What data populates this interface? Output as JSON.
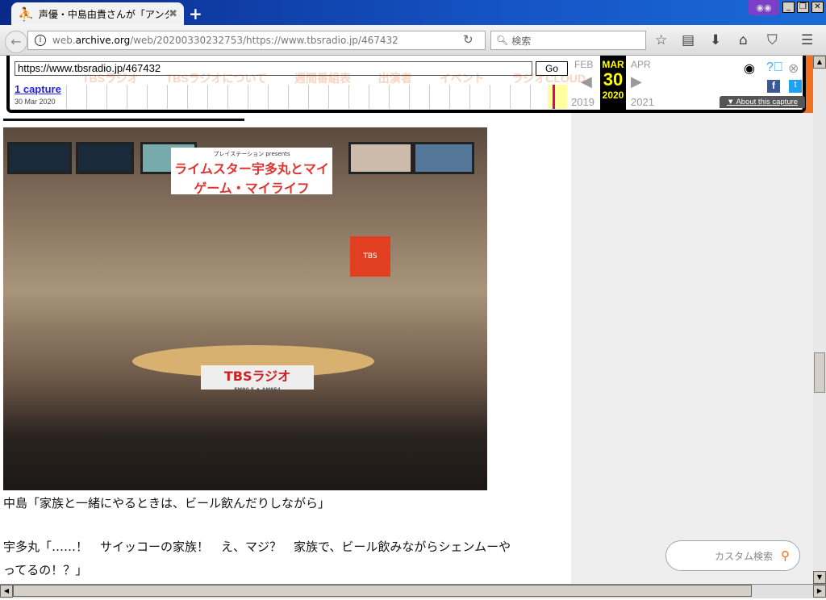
{
  "browser": {
    "tab_title": "声優・中島由貴さんが「アンダ…",
    "url_host_prefix": "web.",
    "url_host": "archive.org",
    "url_path": "/web/20200330232753/https://www.tbsradio.jp/467432",
    "search_placeholder": "検索"
  },
  "wayback": {
    "url": "https://www.tbsradio.jp/467432",
    "go": "Go",
    "captures": "1 capture",
    "capture_date": "30 Mar 2020",
    "prev_month": "FEB",
    "month": "MAR",
    "next_month": "APR",
    "day": "30",
    "prev_year": "2019",
    "year": "2020",
    "next_year": "2021",
    "about": "About this capture"
  },
  "site_nav": [
    "TBSラジオ",
    "TBSラジオについて",
    "週間番組表",
    "出演者",
    "イベント",
    "ラジオCLOUD"
  ],
  "photo": {
    "sign_small": "プレイステーション presents",
    "sign_title": "ライムスター宇多丸とマイゲーム・マイライフ",
    "desk_sign": "TBSラジオ",
    "desk_sub": "FM90.5 ♦ AM954"
  },
  "article": {
    "line1": "中島「家族と一緒にやるときは、ビール飲んだりしながら」",
    "line2": "宇多丸「……！　サイッコーの家族！　え、マジ？　家族で、ビール飲みながらシェンムーや",
    "line3": "ってるの！？」"
  },
  "sidebar": {
    "search_placeholder": "カスタム検索"
  }
}
